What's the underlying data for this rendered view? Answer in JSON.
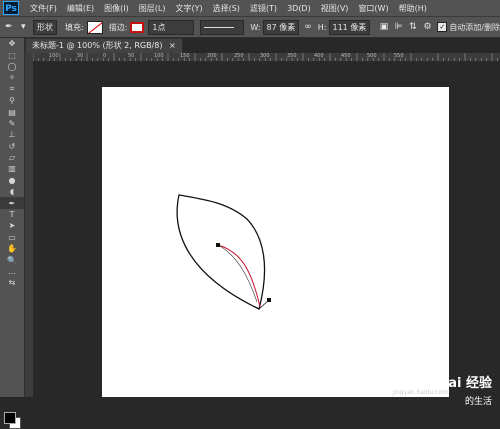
{
  "app": {
    "logo": "Ps"
  },
  "menu": [
    "文件(F)",
    "编辑(E)",
    "图像(I)",
    "图层(L)",
    "文字(Y)",
    "选择(S)",
    "滤镜(T)",
    "3D(D)",
    "视图(V)",
    "窗口(W)",
    "帮助(H)"
  ],
  "options": {
    "tool_mode": "形状",
    "fill_label": "填充:",
    "stroke_label": "描边:",
    "stroke_width": "1点",
    "w_label": "W:",
    "w_value": "87 像素",
    "h_label": "H:",
    "h_value": "111 像素",
    "auto_add_delete": "自动添加/删除"
  },
  "document": {
    "tab_title": "未标题-1 @ 100% (形状 2, RGB/8)"
  },
  "ruler": {
    "ticks": [
      "100",
      "50",
      "0",
      "50",
      "100",
      "150",
      "200",
      "250",
      "300",
      "350",
      "400",
      "450",
      "500",
      "550"
    ]
  },
  "watermark": {
    "brand": "Bai 经验",
    "url": "jingyan.baidu.com",
    "tagline": "的生活"
  }
}
